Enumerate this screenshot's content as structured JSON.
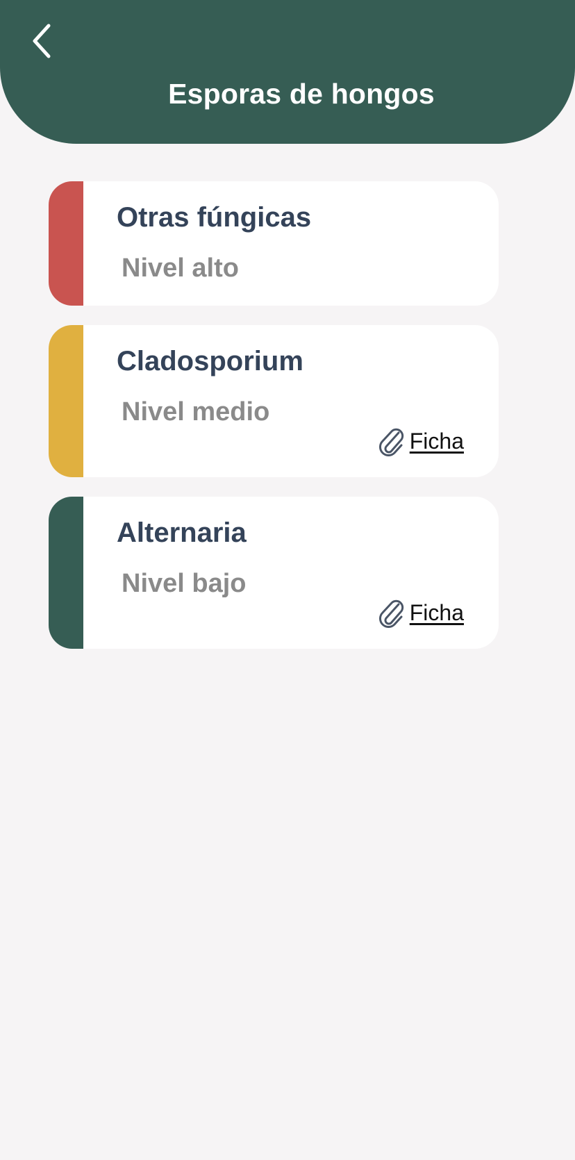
{
  "header": {
    "title": "Esporas de hongos",
    "back_icon": "chevron-left-icon"
  },
  "colors": {
    "header_bg": "#365d54",
    "page_bg": "#f6f4f5",
    "level_high": "#c95450",
    "level_medium": "#e0b040",
    "level_low": "#365d54"
  },
  "items": [
    {
      "name": "Otras fúngicas",
      "level": "Nivel alto",
      "color": "#c95450"
    },
    {
      "name": "Cladosporium",
      "level": "Nivel medio",
      "color": "#e0b040",
      "link_label": "Ficha",
      "link_icon": "paperclip-icon"
    },
    {
      "name": "Alternaria",
      "level": "Nivel bajo",
      "color": "#365d54",
      "link_label": "Ficha",
      "link_icon": "paperclip-icon"
    }
  ]
}
